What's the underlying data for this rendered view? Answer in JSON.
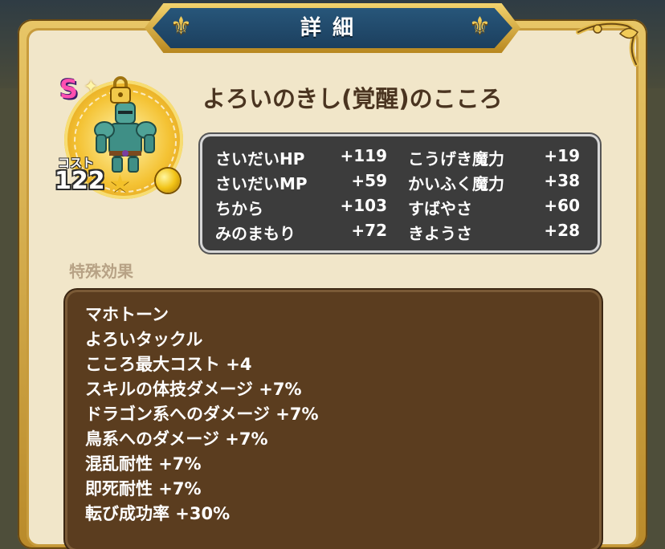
{
  "dialog": {
    "title": "詳細"
  },
  "heart": {
    "name": "よろいのきし(覚醒)のこころ",
    "rank": "S",
    "cost_label": "コスト",
    "cost_value": "122"
  },
  "stats": [
    {
      "label": "さいだいHP",
      "value": "+119"
    },
    {
      "label": "さいだいMP",
      "value": "+59"
    },
    {
      "label": "ちから",
      "value": "+103"
    },
    {
      "label": "みのまもり",
      "value": "+72"
    },
    {
      "label": "こうげき魔力",
      "value": "+19"
    },
    {
      "label": "かいふく魔力",
      "value": "+38"
    },
    {
      "label": "すばやさ",
      "value": "+60"
    },
    {
      "label": "きようさ",
      "value": "+28"
    }
  ],
  "special_effects": {
    "title": "特殊効果",
    "items": [
      "マホトーン",
      "よろいタックル",
      "こころ最大コスト +4",
      "スキルの体技ダメージ +7%",
      "ドラゴン系へのダメージ +7%",
      "鳥系へのダメージ +7%",
      "混乱耐性 +7%",
      "即死耐性 +7%",
      "転び成功率 +30%"
    ]
  },
  "icons": {
    "lock": "lock-icon",
    "sparkle": "sparkle-icon",
    "star": "star-icon",
    "orb": "gold-orb-icon",
    "fleur": "fleur-de-lis-icon"
  },
  "colors": {
    "banner_blue": "#1c3f5e",
    "panel_cream": "#f1e6c9",
    "stats_bg": "#3c3c3c",
    "effects_bg": "#5b3d1f",
    "name_text": "#4a3420",
    "rank_pink": "#ff4fb0"
  }
}
